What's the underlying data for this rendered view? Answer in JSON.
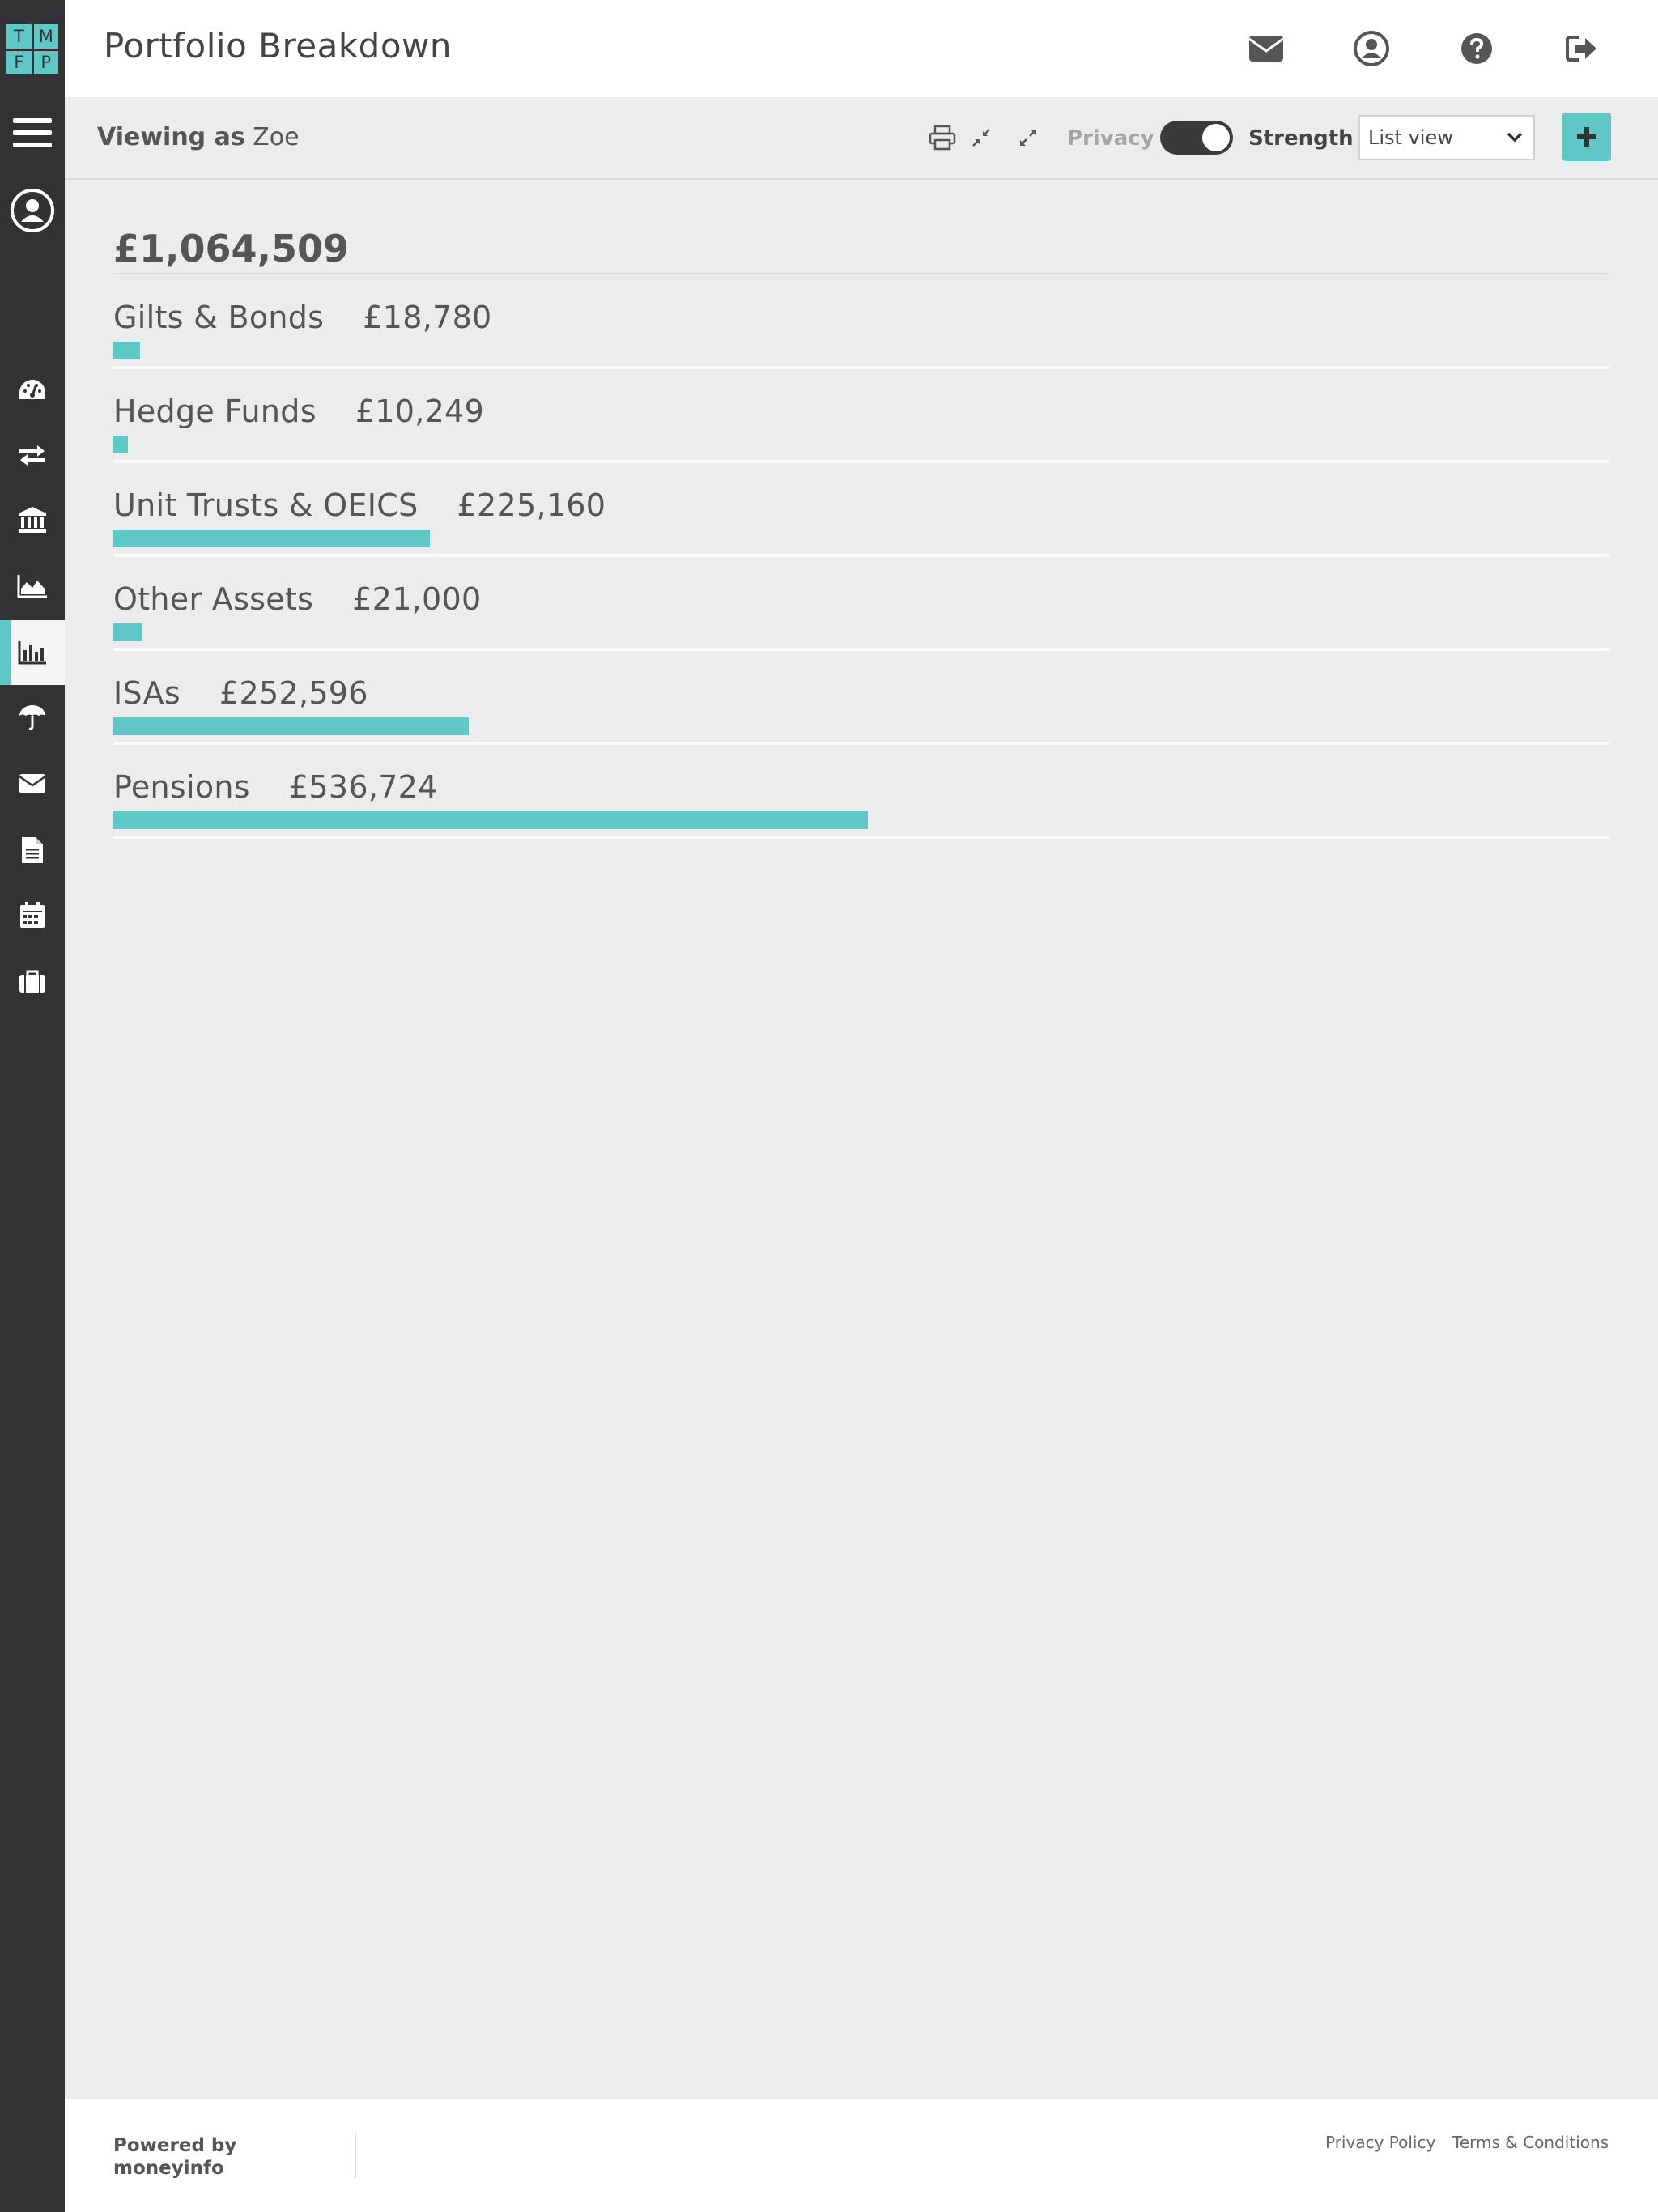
{
  "logo": {
    "letters": [
      "T",
      "M",
      "F",
      "P"
    ]
  },
  "header": {
    "title": "Portfolio Breakdown"
  },
  "toolbar": {
    "viewing_prefix": "Viewing as",
    "viewing_name": "Zoe",
    "privacy_label": "Privacy",
    "privacy_on": true,
    "strength_label": "Strength",
    "view_select_value": "List view"
  },
  "portfolio": {
    "total": "£1,064,509",
    "rows": [
      {
        "name": "Gilts & Bonds",
        "amount": "£18,780",
        "value": 18780
      },
      {
        "name": "Hedge Funds",
        "amount": "£10,249",
        "value": 10249
      },
      {
        "name": "Unit Trusts & OEICS",
        "amount": "£225,160",
        "value": 225160
      },
      {
        "name": "Other Assets",
        "amount": "£21,000",
        "value": 21000
      },
      {
        "name": "ISAs",
        "amount": "£252,596",
        "value": 252596
      },
      {
        "name": "Pensions",
        "amount": "£536,724",
        "value": 536724
      }
    ],
    "bar_max_value": 1064509
  },
  "footer": {
    "powered_line1": "Powered by",
    "powered_line2": "moneyinfo",
    "privacy_policy": "Privacy Policy",
    "terms": "Terms & Conditions"
  },
  "colors": {
    "accent": "#5fc8c6",
    "sidebar": "#333336"
  }
}
